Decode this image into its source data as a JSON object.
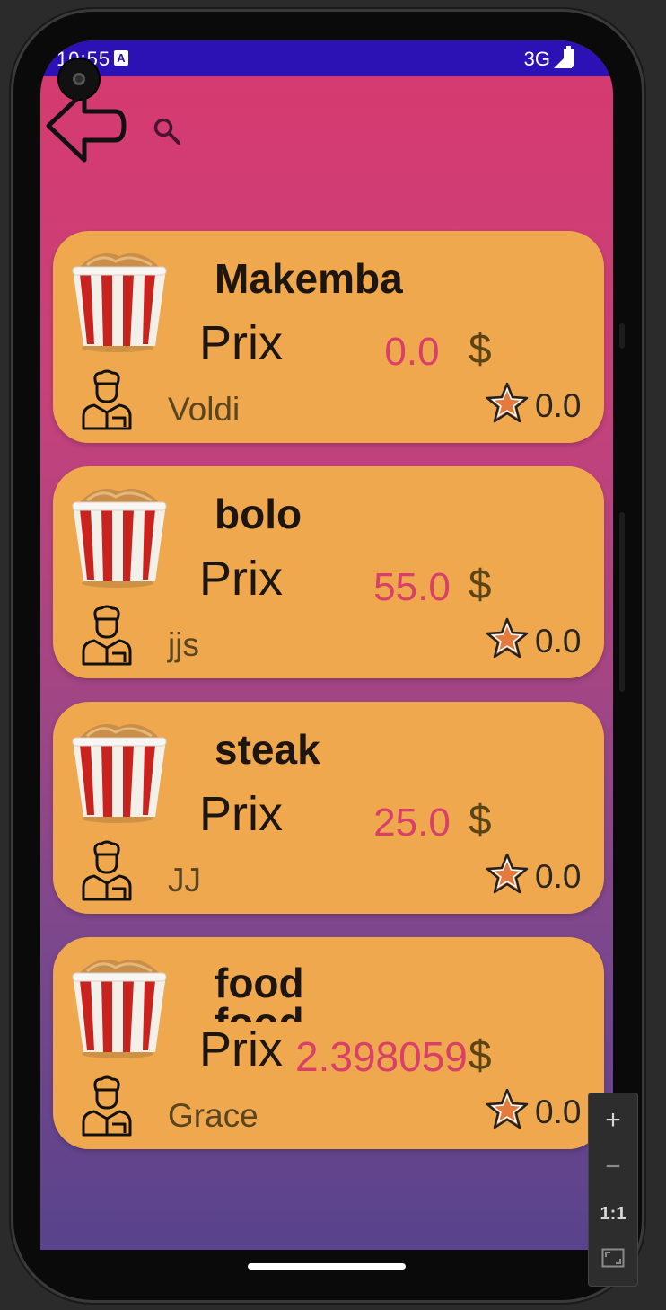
{
  "status_bar": {
    "time": "10:55",
    "notification_badge": "A",
    "network": "3G",
    "icons": [
      "signal-icon",
      "battery-icon"
    ]
  },
  "toolbar": {
    "back_icon": "back-arrow-icon",
    "search_icon": "search-icon"
  },
  "foods": [
    {
      "name": "Makemba",
      "prix_label": "Prix",
      "price": "0.0",
      "currency": "$",
      "cook": "Voldi",
      "rating": "0.0"
    },
    {
      "name": "bolo",
      "prix_label": "Prix",
      "price": "55.0",
      "currency": "$",
      "cook": "jjs",
      "rating": "0.0"
    },
    {
      "name": "steak",
      "prix_label": "Prix",
      "price": "25.0",
      "currency": "$",
      "cook": "JJ",
      "rating": "0.0"
    },
    {
      "name": "food",
      "prix_label": "Prix",
      "price": "2.398059",
      "currency": "$",
      "cook": "Grace",
      "rating": "0.0"
    }
  ],
  "zoom_controls": {
    "zoom_in": "+",
    "zoom_out": "−",
    "actual_size": "1:1",
    "fit_icon": "fit-screen-icon"
  },
  "colors": {
    "status_bar": "#2c11b4",
    "card": "#efa84d",
    "price": "#d8406a",
    "gradient_top": "#d7396e",
    "gradient_bottom": "#58438c"
  }
}
